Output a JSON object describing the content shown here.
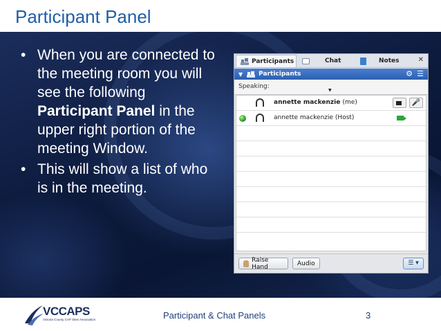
{
  "slide": {
    "title": "Participant Panel",
    "bullets": [
      {
        "before": "When you are connected to the meeting room you will see the following ",
        "bold": "Participant Panel",
        "after": " in the upper right portion of the meeting Window."
      },
      {
        "text": "This will show a list of who is in the meeting."
      }
    ]
  },
  "panel": {
    "tabs": [
      "Participants",
      "Chat",
      "Notes"
    ],
    "pod_title": "Participants",
    "speaking_label": "Speaking:",
    "attendees": [
      {
        "name": "annette mackenzie",
        "suffix": "(me)"
      },
      {
        "name": "annette mackenzie",
        "suffix": "(Host)"
      }
    ],
    "raise_hand_label": "Raise Hand",
    "audio_label": "Audio",
    "options_label": "☰ ▾"
  },
  "footer": {
    "logo_text": "VCCAPS",
    "logo_subtitle": "Victoria County CAP Sites Association",
    "center_text": "Participant & Chat Panels",
    "page_number": "3"
  }
}
